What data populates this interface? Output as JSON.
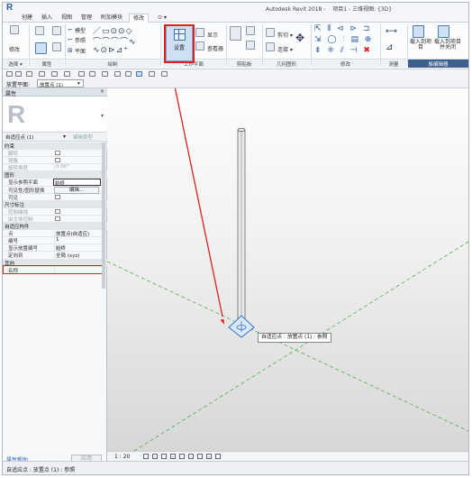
{
  "app": {
    "logo": "R",
    "product": "Autodesk Revit 2018 -",
    "project": "项目1 - 三维视图: {3D}"
  },
  "tabs": [
    "创建",
    "插入",
    "视图",
    "管理",
    "附加模块",
    "修改",
    "⊙ ▾"
  ],
  "ribbon": {
    "modify_label": "修改",
    "select_label": "选择 ▾",
    "properties_label": "属性",
    "draw_label": "绘制",
    "draw_items": [
      "模型",
      "参照",
      "平面"
    ],
    "set_label": "设置",
    "show_label": "显示",
    "viewer_label": "查看器",
    "workplane_group": "工作平面",
    "clipboard_group": "剪贴板",
    "geometry_group": "几何图形",
    "geometry_items": [
      "剪切 ▾",
      "连接 ▾"
    ],
    "modify_group": "修改",
    "measure_group": "测量",
    "load_items": [
      "载入到项目",
      "载入到项目并关闭"
    ],
    "family_editor_group": "族编辑器"
  },
  "options_bar": {
    "label": "放置平面:",
    "value": "放置点 (1)"
  },
  "properties": {
    "title": "属性",
    "close": "×",
    "type_glyph": "R",
    "instance_selector": "自适应点 (1)",
    "edit_type": "编辑类型",
    "rows": [
      {
        "kind": "cat",
        "name": "约束"
      },
      {
        "kind": "prop",
        "name": "翻转",
        "value": "",
        "dim": true,
        "checkbox": true
      },
      {
        "kind": "prop",
        "name": "镜像",
        "value": "",
        "dim": true,
        "checkbox": true
      },
      {
        "kind": "prop",
        "name": "旋转角度",
        "value": "0.00°",
        "dim": true
      },
      {
        "kind": "cat",
        "name": "图形"
      },
      {
        "kind": "prop",
        "name": "显示参照平面",
        "value": "始终",
        "edit": true
      },
      {
        "kind": "prop",
        "name": "可见性/图形替换",
        "value": "",
        "button": "编辑..."
      },
      {
        "kind": "prop",
        "name": "可见",
        "value": "",
        "checkbox": true
      },
      {
        "kind": "cat",
        "name": "尺寸标注"
      },
      {
        "kind": "prop",
        "name": "控制曲线",
        "value": "",
        "dim": true,
        "checkbox": true
      },
      {
        "kind": "prop",
        "name": "由主体控制",
        "value": "",
        "dim": true,
        "checkbox": true
      },
      {
        "kind": "cat",
        "name": "自适应构件"
      },
      {
        "kind": "prop",
        "name": "点",
        "value": "放置点(自适应)"
      },
      {
        "kind": "prop",
        "name": "编号",
        "value": "1"
      },
      {
        "kind": "prop",
        "name": "显示放置编号",
        "value": "始终"
      },
      {
        "kind": "prop",
        "name": "定向到",
        "value": "全局 (xyz)",
        "highlight": true
      },
      {
        "kind": "cat",
        "name": "其他"
      },
      {
        "kind": "prop",
        "name": "名称",
        "value": ""
      }
    ],
    "help_link": "属性帮助",
    "apply": "应用"
  },
  "view": {
    "tooltip": "自适应点 : 放置点 (1) : 参照",
    "scale": "1 : 20"
  },
  "status": {
    "text": "自适应点 : 放置点 (1) : 参照"
  },
  "colors": {
    "highlight": "#e02020",
    "selection": "#2d6fd1",
    "ribbon_active_group": "#3d5f8b"
  }
}
